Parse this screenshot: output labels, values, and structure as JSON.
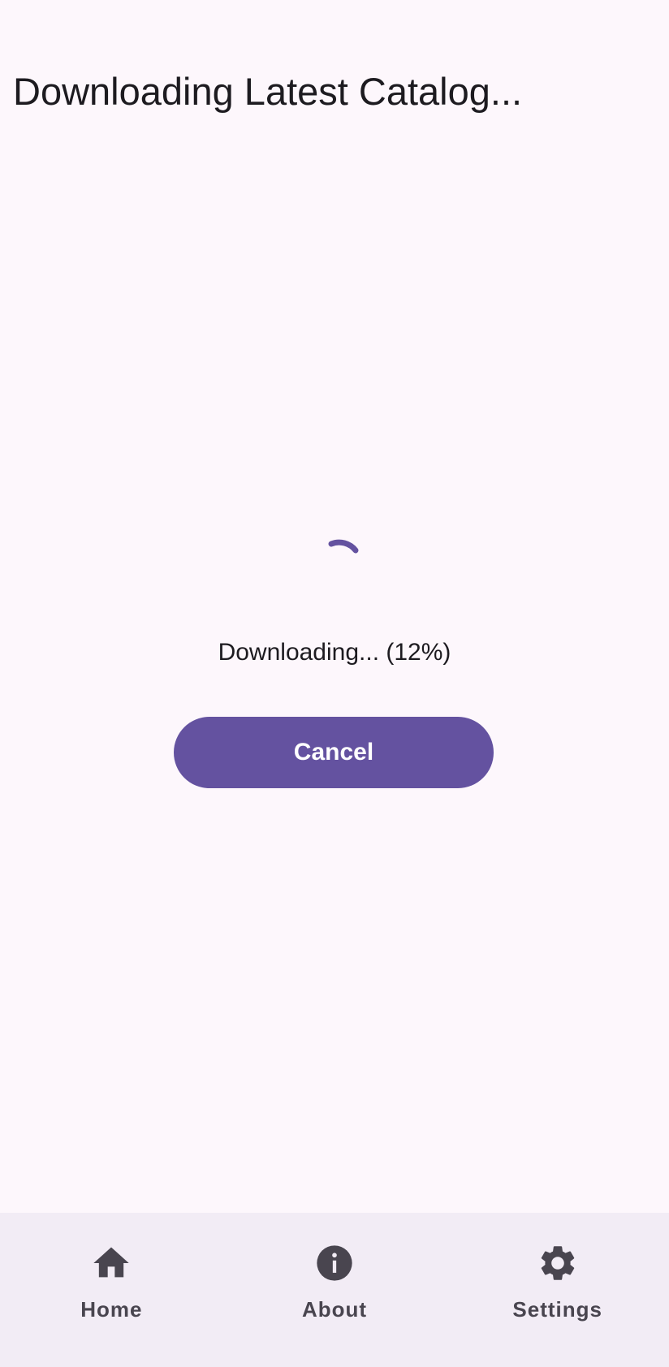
{
  "header": {
    "title": "Downloading Latest Catalog..."
  },
  "progress": {
    "percent": 12,
    "status_text": "Downloading... (12%)"
  },
  "actions": {
    "cancel_label": "Cancel"
  },
  "nav": {
    "items": [
      {
        "label": "Home",
        "icon": "home-icon"
      },
      {
        "label": "About",
        "icon": "info-icon"
      },
      {
        "label": "Settings",
        "icon": "gear-icon"
      }
    ]
  },
  "colors": {
    "accent": "#6452a0",
    "background": "#fdf7fc",
    "nav_background": "#f2ecf5",
    "icon": "#49454f"
  }
}
